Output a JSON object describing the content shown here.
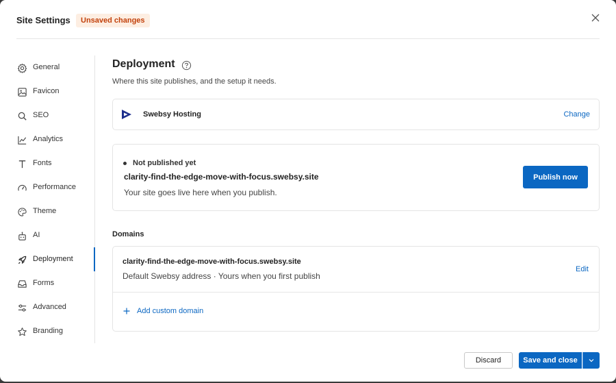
{
  "header": {
    "title": "Site Settings",
    "badge": "Unsaved changes"
  },
  "sidebar": {
    "items": [
      {
        "label": "General",
        "icon": "gear-icon"
      },
      {
        "label": "Favicon",
        "icon": "image-icon"
      },
      {
        "label": "SEO",
        "icon": "search-icon"
      },
      {
        "label": "Analytics",
        "icon": "line-chart-icon"
      },
      {
        "label": "Fonts",
        "icon": "text-icon"
      },
      {
        "label": "Performance",
        "icon": "gauge-icon"
      },
      {
        "label": "Theme",
        "icon": "palette-icon"
      },
      {
        "label": "AI",
        "icon": "robot-icon"
      },
      {
        "label": "Deployment",
        "icon": "rocket-icon",
        "active": true
      },
      {
        "label": "Forms",
        "icon": "inbox-icon"
      },
      {
        "label": "Advanced",
        "icon": "sliders-icon"
      },
      {
        "label": "Branding",
        "icon": "star-icon"
      }
    ]
  },
  "main": {
    "title": "Deployment",
    "subtitle": "Where this site publishes, and the setup it needs.",
    "hosting": {
      "name": "Swebsy Hosting",
      "change_label": "Change"
    },
    "publish": {
      "status": "Not published yet",
      "url": "clarity-find-the-edge-move-with-focus.swebsy.site",
      "note": "Your site goes live here when you publish.",
      "button_label": "Publish now"
    },
    "domains": {
      "section_label": "Domains",
      "url": "clarity-find-the-edge-move-with-focus.swebsy.site",
      "description": "Default Swebsy address · Yours when you first publish",
      "edit_label": "Edit",
      "add_label": "Add custom domain"
    }
  },
  "footer": {
    "discard_label": "Discard",
    "save_label": "Save and close"
  },
  "colors": {
    "accent": "#0b67c2",
    "badge_bg": "#fdeee2",
    "badge_text": "#c2410c",
    "logo": "#1c2e8c"
  }
}
